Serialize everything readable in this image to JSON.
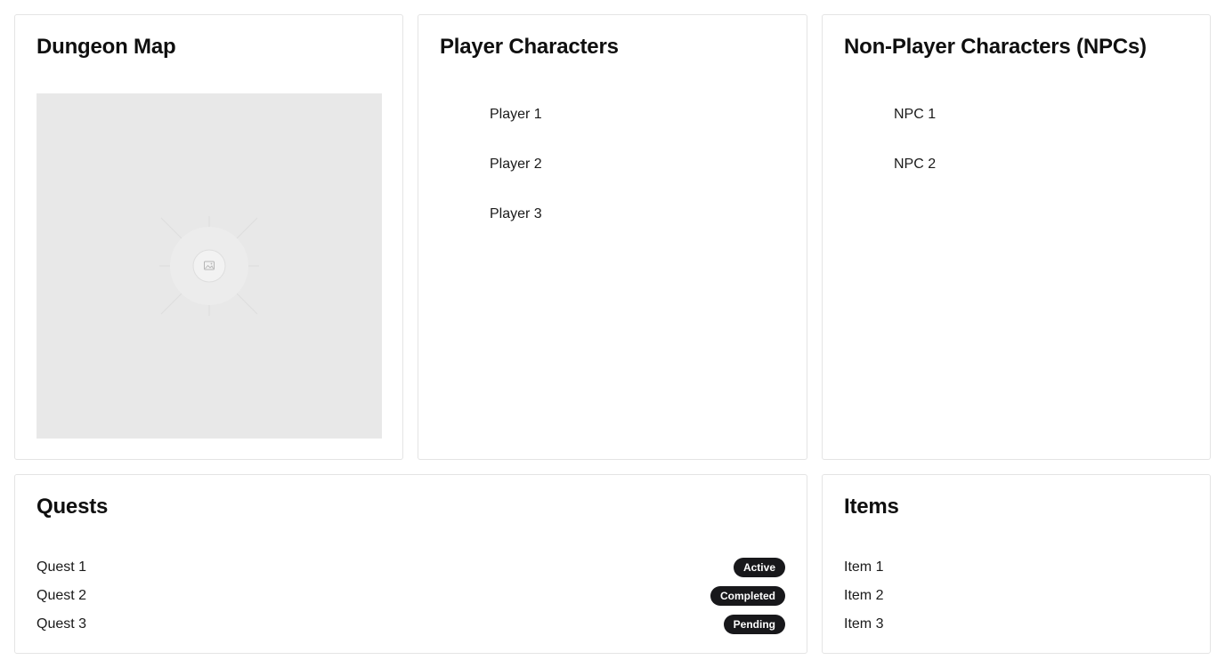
{
  "dungeon_map": {
    "title": "Dungeon Map",
    "image_icon": "image-placeholder-icon"
  },
  "players": {
    "title": "Player Characters",
    "items": [
      "Player 1",
      "Player 2",
      "Player 3"
    ]
  },
  "npcs": {
    "title": "Non-Player Characters (NPCs)",
    "items": [
      "NPC 1",
      "NPC 2"
    ]
  },
  "quests": {
    "title": "Quests",
    "items": [
      {
        "name": "Quest 1",
        "status": "Active"
      },
      {
        "name": "Quest 2",
        "status": "Completed"
      },
      {
        "name": "Quest 3",
        "status": "Pending"
      }
    ]
  },
  "items": {
    "title": "Items",
    "items": [
      "Item 1",
      "Item 2",
      "Item 3"
    ]
  },
  "colors": {
    "badge_bg": "#18181b",
    "badge_text": "#ffffff",
    "card_border": "#e4e4e4",
    "placeholder_bg": "#e8e8e8"
  }
}
